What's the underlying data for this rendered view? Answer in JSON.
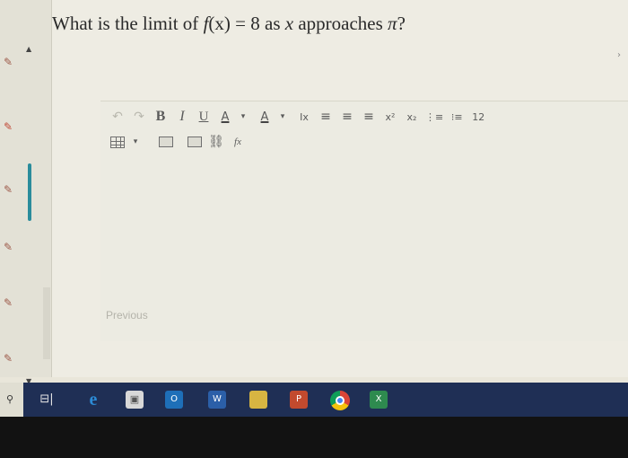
{
  "question": {
    "prefix": "What is the limit of ",
    "func": "f",
    "arg": "(x)",
    "equals": " = 8 as ",
    "var": "x",
    "suffix": " approaches ",
    "pi": "π",
    "qmark": "?"
  },
  "toolbar": {
    "undo": "↶",
    "redo": "↷",
    "bold": "B",
    "italic": "I",
    "underline": "U",
    "font_color": "A",
    "highlight": "A",
    "clear_format": "Ix",
    "align_left": "≡",
    "align_center": "≡",
    "align_right": "≡",
    "superscript": "x²",
    "subscript": "x₂",
    "bullet_list": "⋮≡",
    "numbered_list": "⁝≡",
    "font_size": "12",
    "link": "⛓",
    "formula": "fx",
    "dropdown_caret": "▾"
  },
  "editor": {
    "previous_label": "Previous"
  },
  "rail": {
    "collapse_arrow": "▲",
    "expand_arrow": "▼"
  },
  "taskbar": {
    "taskview": "⊟|",
    "edge": "e",
    "store": "▣",
    "outlook": "O",
    "word": "W",
    "powerpoint": "P",
    "excel": "X"
  },
  "colors": {
    "rail_icon": "#9d5a4a",
    "accent_bar": "#2a8c9c",
    "taskbar": "#1f2f55"
  }
}
